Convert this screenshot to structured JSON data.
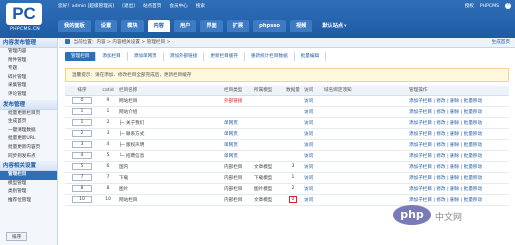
{
  "header": {
    "logo_text": "PC",
    "logo_sub": "PHPCMS.CN",
    "topbar": [
      "您好！admin [超级管理员]",
      "[退出]",
      "站点首页",
      "会员中心",
      "搜索"
    ],
    "topright": [
      "授权",
      "PHPCMS"
    ],
    "nav": [
      "我的面板",
      "设置",
      "模块",
      "内容",
      "用户",
      "界面",
      "扩展",
      "phpsso",
      "视频"
    ],
    "active_nav": 3,
    "site_select": "默认站点"
  },
  "sidebar": {
    "sections": [
      {
        "title": "内容发布管理",
        "items": [
          "管理内容",
          "附件管理",
          "专题",
          "碎片管理",
          "采集管理",
          "评论管理"
        ]
      },
      {
        "title": "发布管理",
        "items": [
          "批量更新栏目页",
          "生成首页",
          "一键清理数据",
          "批量更新URL",
          "批量更新内容页",
          "同步到发布点"
        ]
      },
      {
        "title": "内容相关设置",
        "items": [
          "管理栏目",
          "模型管理",
          "类别管理",
          "推荐位管理"
        ]
      }
    ],
    "active_item": "管理栏目"
  },
  "content": {
    "crumb": "当前位置：内容 > 内容相关设置 > 管理栏目 >",
    "crumb_right": "生成首页",
    "subtabs": [
      "管理栏目",
      "添加栏目",
      "添加单网页",
      "添加外部链接",
      "更新栏目缓存",
      "重新统计栏目数据",
      "批量编辑"
    ],
    "active_subtab": 0,
    "notice": "温馨提示：请在添加、修改栏目全部完成后，更新栏目缓存",
    "table": {
      "headers": [
        "排序",
        "catid",
        "栏目名称",
        "栏目类型",
        "所属模型",
        "数据量",
        "访问",
        "域名绑定须知",
        "管理操作"
      ],
      "rows": [
        {
          "order": "0",
          "catid": "9",
          "name": "网站栏目",
          "type": "外部链接",
          "type_color": "red",
          "model": "",
          "count": "",
          "visit": "访问",
          "ops": "添加子栏目 | 修改 | 删除 | 批量移动"
        },
        {
          "order": "1",
          "catid": "1",
          "name": "网站介绍",
          "type": "",
          "type_color": "",
          "model": "",
          "count": "",
          "visit": "访问",
          "ops": "添加子栏目 | 修改 | 删除 | 批量移动"
        },
        {
          "order": "1",
          "catid": "2",
          "name": "├─ 关于我们",
          "type": "单网页",
          "type_color": "blue",
          "model": "",
          "count": "",
          "visit": "访问",
          "ops": "添加子栏目 | 修改 | 删除 | 批量移动"
        },
        {
          "order": "2",
          "catid": "3",
          "name": "├─ 联系方式",
          "type": "单网页",
          "type_color": "blue",
          "model": "",
          "count": "",
          "visit": "访问",
          "ops": "添加子栏目 | 修改 | 删除 | 批量移动"
        },
        {
          "order": "3",
          "catid": "4",
          "name": "├─ 版权声明",
          "type": "单网页",
          "type_color": "blue",
          "model": "",
          "count": "",
          "visit": "访问",
          "ops": "添加子栏目 | 修改 | 删除 | 批量移动"
        },
        {
          "order": "4",
          "catid": "5",
          "name": "└─ 招聘信息",
          "type": "单网页",
          "type_color": "blue",
          "model": "",
          "count": "",
          "visit": "访问",
          "ops": "添加子栏目 | 修改 | 删除 | 批量移动"
        },
        {
          "order": "5",
          "catid": "6",
          "name": "国内",
          "type": "内部栏目",
          "type_color": "",
          "model": "文章模型",
          "count": "3",
          "visit": "访问",
          "ops": "添加子栏目 | 修改 | 删除 | 批量移动"
        },
        {
          "order": "7",
          "catid": "7",
          "name": "下载",
          "type": "内部栏目",
          "type_color": "",
          "model": "下载模型",
          "count": "1",
          "visit": "访问",
          "ops": "添加子栏目 | 修改 | 删除 | 批量移动"
        },
        {
          "order": "8",
          "catid": "8",
          "name": "图片",
          "type": "内部栏目",
          "type_color": "",
          "model": "图片模型",
          "count": "2",
          "visit": "访问",
          "ops": "添加子栏目 | 修改 | 删除 | 批量移动"
        },
        {
          "order": "10",
          "catid": "10",
          "name": "网站栏目",
          "type": "内部栏目",
          "type_color": "",
          "model": "文章模型",
          "count": "0",
          "count_highlight": true,
          "visit": "访问",
          "ops": "添加子栏目 | 修改 | 删除 | 批量移动"
        }
      ]
    },
    "sort_button": "排序"
  },
  "watermark": {
    "logo": "php",
    "text": "中文网"
  },
  "colors": {
    "header": "#1f5ba5",
    "accent": "#2f6fb8",
    "highlight": "#dd2222"
  }
}
